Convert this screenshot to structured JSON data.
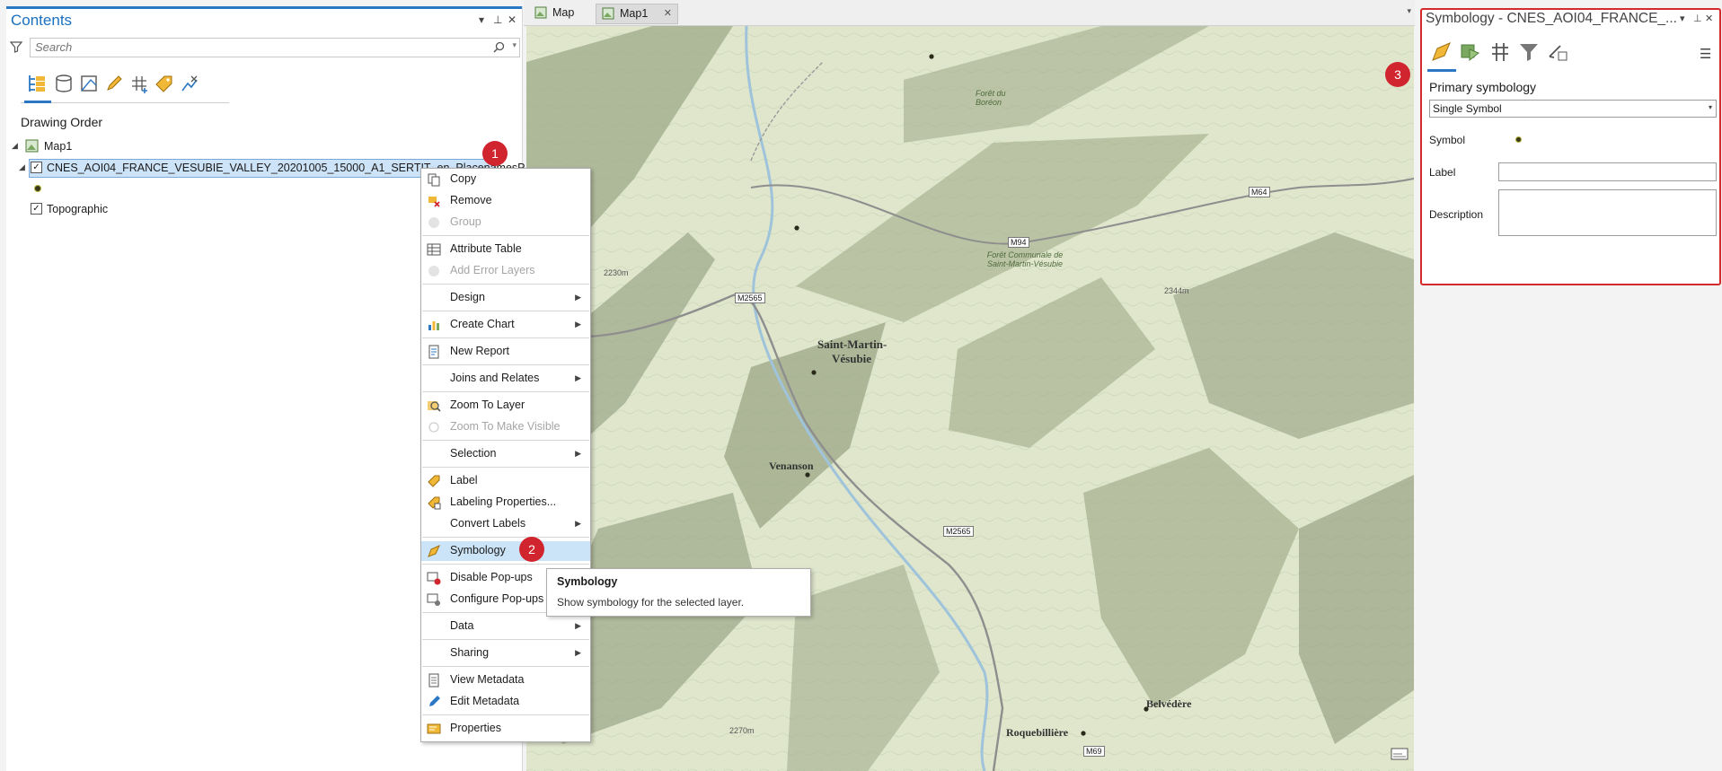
{
  "contents": {
    "title": "Contents",
    "search_placeholder": "Search",
    "drawing_order_label": "Drawing Order",
    "tree": {
      "map_name": "Map1",
      "layer_name": "CNES_AOI04_FRANCE_VESUBIE_VALLEY_20201005_15000_A1_SERTIT_en_PlacenamesP_1",
      "basemap_name": "Topographic"
    }
  },
  "map_tabs": [
    {
      "label": "Map"
    },
    {
      "label": "Map1"
    }
  ],
  "map_labels": {
    "town1": "Saint-Martin-",
    "town1b": "Vésubie",
    "town2": "Venanson",
    "town3": "Belvédère",
    "town4": "Roquebillière",
    "road1": "M2565",
    "road2": "M94",
    "road3": "M64",
    "road4": "M2565",
    "road5": "M69",
    "elev1": "2344m",
    "elev2": "2230m",
    "elev3": "2270m",
    "forest1": "Forêt du Boréon",
    "forest2": "Forêt Communale de Saint-Martin-Vésubie"
  },
  "context_menu": {
    "items": [
      {
        "label": "Copy"
      },
      {
        "label": "Remove"
      },
      {
        "label": "Group"
      },
      {
        "label": "Attribute Table"
      },
      {
        "label": "Add Error Layers"
      },
      {
        "label": "Design"
      },
      {
        "label": "Create Chart"
      },
      {
        "label": "New Report"
      },
      {
        "label": "Joins and Relates"
      },
      {
        "label": "Zoom To Layer"
      },
      {
        "label": "Zoom To Make Visible"
      },
      {
        "label": "Selection"
      },
      {
        "label": "Label"
      },
      {
        "label": "Labeling Properties..."
      },
      {
        "label": "Convert Labels"
      },
      {
        "label": "Symbology"
      },
      {
        "label": "Disable Pop-ups"
      },
      {
        "label": "Configure Pop-ups"
      },
      {
        "label": "Data"
      },
      {
        "label": "Sharing"
      },
      {
        "label": "View Metadata"
      },
      {
        "label": "Edit Metadata"
      },
      {
        "label": "Properties"
      }
    ]
  },
  "tooltip": {
    "title": "Symbology",
    "description": "Show symbology for the selected layer."
  },
  "badges": [
    "1",
    "2",
    "3"
  ],
  "symbology": {
    "title": "Symbology - CNES_AOI04_FRANCE_...",
    "primary_label": "Primary symbology",
    "primary_value": "Single Symbol",
    "symbol_label": "Symbol",
    "label_label": "Label",
    "description_label": "Description"
  },
  "colors": {
    "accent": "#2b77c3",
    "badge": "#d0242e",
    "highlight_border": "#d42a2a",
    "menu_hover": "#cce4f7"
  }
}
